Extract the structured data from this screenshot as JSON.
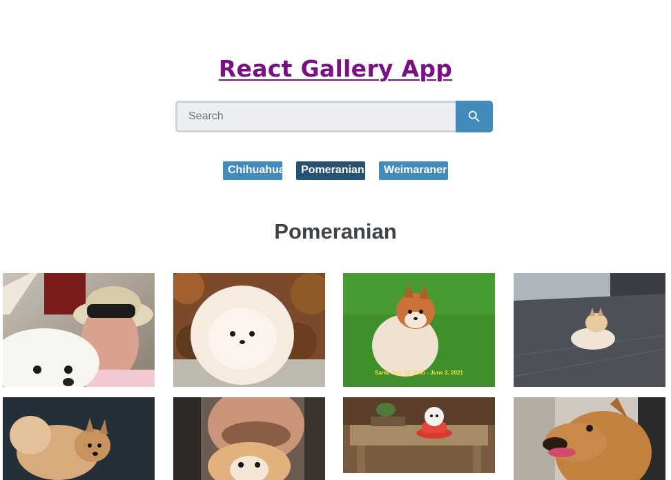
{
  "header": {
    "title": "React Gallery App"
  },
  "search": {
    "placeholder": "Search",
    "value": "",
    "button_icon": "search-icon"
  },
  "nav": {
    "links": [
      {
        "label": "Chihuahua",
        "active": false
      },
      {
        "label": "Pomeranian",
        "active": true
      },
      {
        "label": "Weimaraner",
        "active": false
      }
    ]
  },
  "results": {
    "heading": "Pomeranian",
    "photos": [
      {
        "subject": "man-in-hat-with-white-pomeranian"
      },
      {
        "subject": "fluffy-cream-pomeranian"
      },
      {
        "subject": "orange-pomeranian-on-grass",
        "caption": "Sami, July 23, 2005 - June 3, 2021"
      },
      {
        "subject": "pomeranian-lying-on-pavement"
      },
      {
        "subject": "tan-pomeranian-dark-background"
      },
      {
        "subject": "man-with-pomeranian-under-chin"
      },
      {
        "subject": "puppy-in-teacup-on-table"
      },
      {
        "subject": "brown-dog-open-mouth"
      }
    ]
  },
  "colors": {
    "title": "#7b0f86",
    "accent": "#438bbd",
    "active_nav": "#275273",
    "heading": "#3c4449"
  }
}
